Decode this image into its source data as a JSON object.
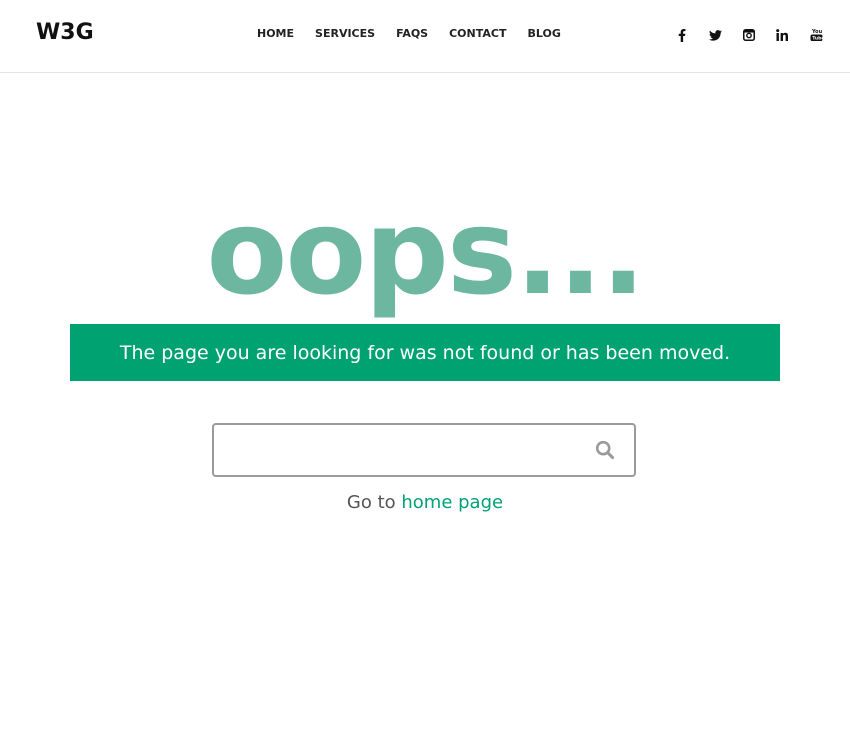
{
  "header": {
    "logo": "W3G",
    "nav": [
      {
        "label": "HOME"
      },
      {
        "label": "SERVICES"
      },
      {
        "label": "FAQS"
      },
      {
        "label": "CONTACT"
      },
      {
        "label": "BLOG"
      }
    ],
    "social": [
      {
        "icon": "facebook-icon"
      },
      {
        "icon": "twitter-icon"
      },
      {
        "icon": "instagram-icon"
      },
      {
        "icon": "linkedin-icon"
      },
      {
        "icon": "youtube-icon"
      }
    ]
  },
  "main": {
    "heading": "oops...",
    "message": "The page you are looking for was not found or has been moved.",
    "search": {
      "value": "",
      "placeholder": "",
      "icon": "search-icon"
    },
    "goto_prefix": "Go to ",
    "goto_link": "home page"
  },
  "colors": {
    "accent": "#00a272",
    "heading": "#6db7a0",
    "text": "#555555",
    "nav_text": "#222222"
  }
}
